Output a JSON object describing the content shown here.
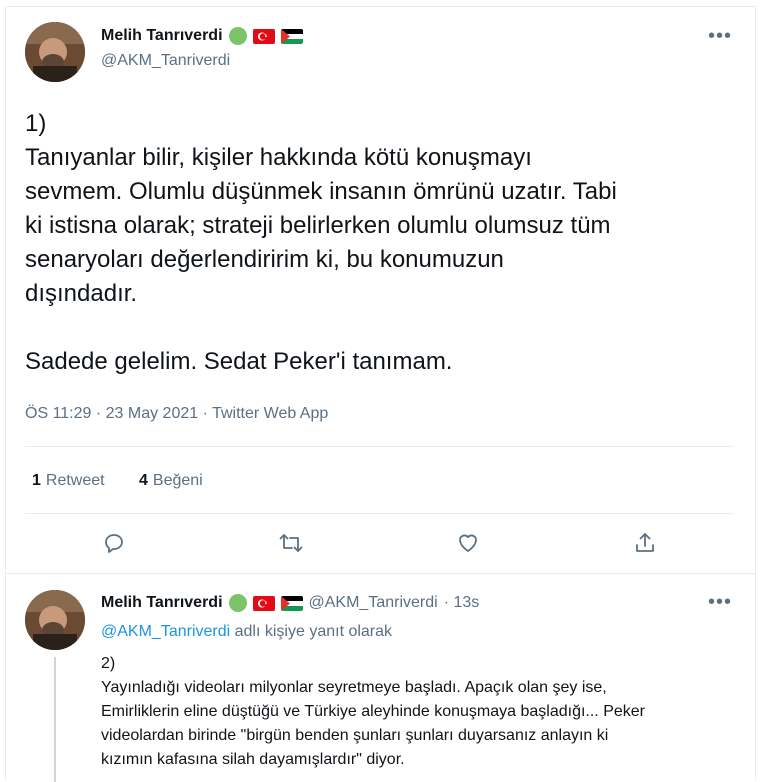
{
  "main_tweet": {
    "author_name": "Melih Tanrıverdi",
    "author_handle": "@AKM_Tanriverdi",
    "text": "1)\nTanıyanlar bilir, kişiler hakkında kötü konuşmayı\nsevmem. Olumlu düşünmek insanın ömrünü uzatır. Tabi\nki istisna olarak; strateji belirlerken olumlu olumsuz tüm\nsenaryoları değerlendiririm ki, bu konumuzun\ndışındadır.\n\nSadede gelelim. Sedat Peker'i tanımam.",
    "timestamp": "ÖS 11:29 · 23 May 2021 · Twitter Web App",
    "retweets_count": "1",
    "retweets_label": "Retweet",
    "likes_count": "4",
    "likes_label": "Beğeni"
  },
  "reply_tweet": {
    "author_name": "Melih Tanrıverdi",
    "author_handle": "@AKM_Tanriverdi",
    "time_ago": "· 13s",
    "reply_to_handle": "@AKM_Tanriverdi",
    "reply_to_suffix": "adlı kişiye yanıt olarak",
    "text": "2)\nYayınladığı videoları milyonlar seyretmeye başladı. Apaçık olan şey ise,\nEmirliklerin eline düştüğü ve Türkiye aleyhinde konuşmaya başladığı... Peker\nvideolardan birinde \"birgün benden şunları şunları duyarsanız anlayın ki\nkızımın kafasına silah dayamışlardır\" diyor."
  },
  "icons": {
    "more": "more-horizontal-icon",
    "reply": "reply-icon",
    "retweet": "retweet-icon",
    "like": "heart-icon",
    "share": "share-icon"
  },
  "colors": {
    "text": "#0f1419",
    "secondary": "#5b7083",
    "link": "#1b95e0",
    "separator": "#e6ecf0",
    "status_badge": "#7cc46a"
  }
}
